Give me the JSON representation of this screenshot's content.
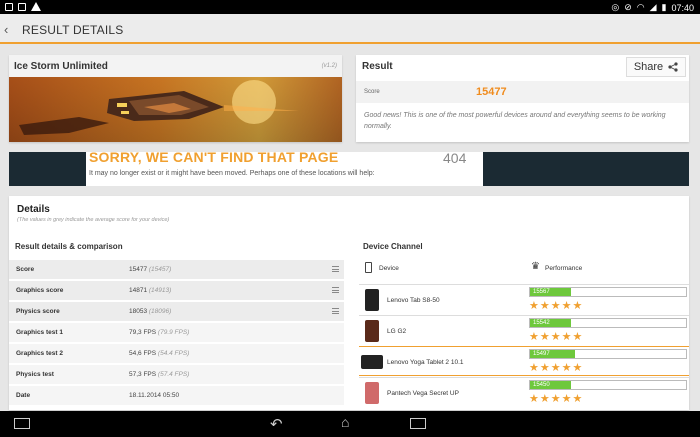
{
  "statusbar": {
    "time": "07:40"
  },
  "appbar": {
    "back_icon": "‹",
    "title": "RESULT DETAILS"
  },
  "test": {
    "name": "Ice Storm Unlimited",
    "version": "(v1.2)"
  },
  "result": {
    "title": "Result",
    "share_label": "Share",
    "score_label": "Score",
    "score": "15477",
    "message": "Good news! This is one of the most powerful devices around and everything seems to be working normally."
  },
  "banner": {
    "headline": "SORRY, WE CAN'T FIND THAT PAGE",
    "code": "404",
    "sub": "It may no longer exist or it might have been moved. Perhaps one of these locations will help:"
  },
  "details": {
    "title": "Details",
    "subtitle": "(The values in grey indicate the average score for your device)",
    "results_heading": "Result details & comparison",
    "channel_heading": "Device Channel",
    "col_device": "Device",
    "col_performance": "Performance",
    "rows": [
      {
        "label": "Score",
        "value": "15477",
        "avg": "(15457)"
      },
      {
        "label": "Graphics score",
        "value": "14871",
        "avg": "(14913)"
      },
      {
        "label": "Physics score",
        "value": "18053",
        "avg": "(18096)"
      },
      {
        "label": "Graphics test 1",
        "value": "79,3 FPS",
        "avg": "(79.9 FPS)"
      },
      {
        "label": "Graphics test 2",
        "value": "54,6 FPS",
        "avg": "(54.4 FPS)"
      },
      {
        "label": "Physics test",
        "value": "57,3 FPS",
        "avg": "(57.4 FPS)"
      },
      {
        "label": "Date",
        "value": "18.11.2014 05:50",
        "avg": ""
      }
    ],
    "devices": [
      {
        "name": "Lenovo Tab S8-50",
        "score": "15567",
        "bar_fraction": 0.26,
        "stars": "★★★★★"
      },
      {
        "name": "LG G2",
        "score": "15542",
        "bar_fraction": 0.26,
        "stars": "★★★★★"
      },
      {
        "name": "Lenovo Yoga Tablet 2 10.1",
        "score": "15497",
        "bar_fraction": 0.29,
        "stars": "★★★★★"
      },
      {
        "name": "Pantech Vega Secret UP",
        "score": "15450",
        "bar_fraction": 0.26,
        "stars": "★★★★★"
      }
    ]
  },
  "colors": {
    "accent": "#f0a030",
    "bar": "#6ec83c",
    "stars": "#f0a030"
  }
}
